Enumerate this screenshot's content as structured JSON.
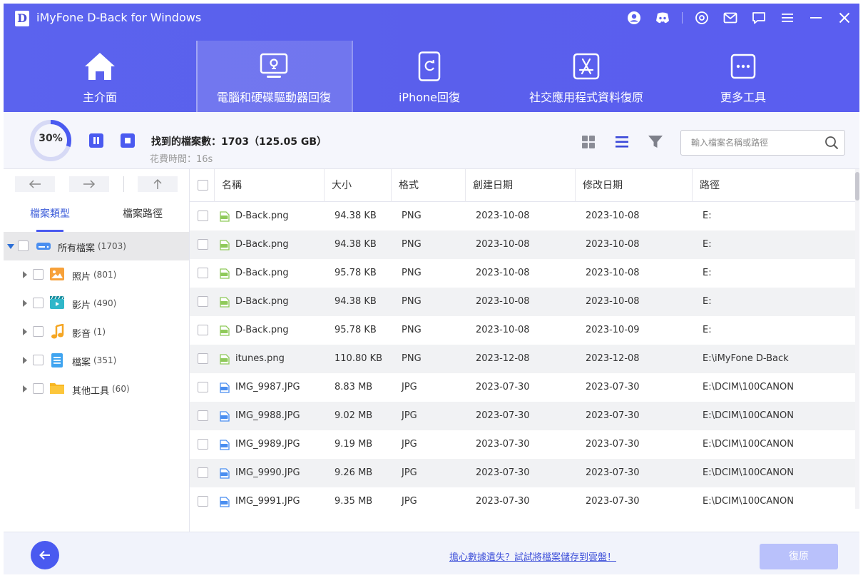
{
  "app": {
    "logo_letter": "D",
    "title": "iMyFone D-Back for Windows"
  },
  "titlebar_icons": [
    "user-icon",
    "discord-icon",
    "settings-icon",
    "mail-icon",
    "chat-icon",
    "menu-icon",
    "minimize-icon",
    "close-icon"
  ],
  "nav": [
    {
      "label": "主介面",
      "icon": "home-icon"
    },
    {
      "label": "電腦和硬碟驅動器回復",
      "icon": "computer-drive-icon",
      "active": true
    },
    {
      "label": "iPhone回復",
      "icon": "iphone-icon"
    },
    {
      "label": "社交應用程式資料復原",
      "icon": "app-store-icon"
    },
    {
      "label": "更多工具",
      "icon": "more-tools-icon"
    }
  ],
  "scan": {
    "percent_label": "30%",
    "progress": 0.3,
    "found_label": "找到的檔案數：1703（125.05 GB）",
    "elapsed_label": "花費時間：16s"
  },
  "search": {
    "placeholder": "輸入檔案名稱或路徑"
  },
  "colors": {
    "accent": "#4a5af0",
    "header": "#5a60ee",
    "link": "#3d4fd9",
    "recover_disabled": "#b9c1fb"
  },
  "sidebar": {
    "tabs": [
      "檔案類型",
      "檔案路徑"
    ],
    "active_tab": 0,
    "tree": [
      {
        "label": "所有檔案",
        "count": "(1703)",
        "icon": "drive-icon",
        "expanded": true
      },
      {
        "label": "照片",
        "count": "(801)",
        "icon": "photo-icon"
      },
      {
        "label": "影片",
        "count": "(490)",
        "icon": "video-icon"
      },
      {
        "label": "影音",
        "count": "(1)",
        "icon": "music-icon"
      },
      {
        "label": "檔案",
        "count": "(351)",
        "icon": "document-icon"
      },
      {
        "label": "其他工具",
        "count": "(60)",
        "icon": "folder-icon"
      }
    ]
  },
  "table": {
    "columns": [
      "名稱",
      "大小",
      "格式",
      "創建日期",
      "修改日期",
      "路徑"
    ],
    "rows": [
      {
        "name": "D-Back.png",
        "size": "94.38 KB",
        "format": "PNG",
        "created": "2023-10-08",
        "modified": "2023-10-08",
        "path": "E:",
        "icon": "png-icon"
      },
      {
        "name": "D-Back.png",
        "size": "94.38 KB",
        "format": "PNG",
        "created": "2023-10-08",
        "modified": "2023-10-08",
        "path": "E:",
        "icon": "png-icon"
      },
      {
        "name": "D-Back.png",
        "size": "95.78 KB",
        "format": "PNG",
        "created": "2023-10-08",
        "modified": "2023-10-08",
        "path": "E:",
        "icon": "png-icon"
      },
      {
        "name": "D-Back.png",
        "size": "94.38 KB",
        "format": "PNG",
        "created": "2023-10-08",
        "modified": "2023-10-08",
        "path": "E:",
        "icon": "png-icon"
      },
      {
        "name": "D-Back.png",
        "size": "95.78 KB",
        "format": "PNG",
        "created": "2023-10-08",
        "modified": "2023-10-09",
        "path": "E:",
        "icon": "png-icon"
      },
      {
        "name": "itunes.png",
        "size": "110.80 KB",
        "format": "PNG",
        "created": "2023-12-08",
        "modified": "2023-12-08",
        "path": "E:\\iMyFone D-Back",
        "icon": "png-icon"
      },
      {
        "name": "IMG_9987.JPG",
        "size": "8.83 MB",
        "format": "JPG",
        "created": "2023-07-30",
        "modified": "2023-07-30",
        "path": "E:\\DCIM\\100CANON",
        "icon": "jpg-icon"
      },
      {
        "name": "IMG_9988.JPG",
        "size": "9.02 MB",
        "format": "JPG",
        "created": "2023-07-30",
        "modified": "2023-07-30",
        "path": "E:\\DCIM\\100CANON",
        "icon": "jpg-icon"
      },
      {
        "name": "IMG_9989.JPG",
        "size": "9.19 MB",
        "format": "JPG",
        "created": "2023-07-30",
        "modified": "2023-07-30",
        "path": "E:\\DCIM\\100CANON",
        "icon": "jpg-icon"
      },
      {
        "name": "IMG_9990.JPG",
        "size": "9.26 MB",
        "format": "JPG",
        "created": "2023-07-30",
        "modified": "2023-07-30",
        "path": "E:\\DCIM\\100CANON",
        "icon": "jpg-icon"
      },
      {
        "name": "IMG_9991.JPG",
        "size": "9.35 MB",
        "format": "JPG",
        "created": "2023-07-30",
        "modified": "2023-07-30",
        "path": "E:\\DCIM\\100CANON",
        "icon": "jpg-icon"
      }
    ]
  },
  "footer": {
    "cloud_link": "擔心數據遺失？試試將檔案儲存到雲盤！",
    "recover_label": "復原"
  }
}
